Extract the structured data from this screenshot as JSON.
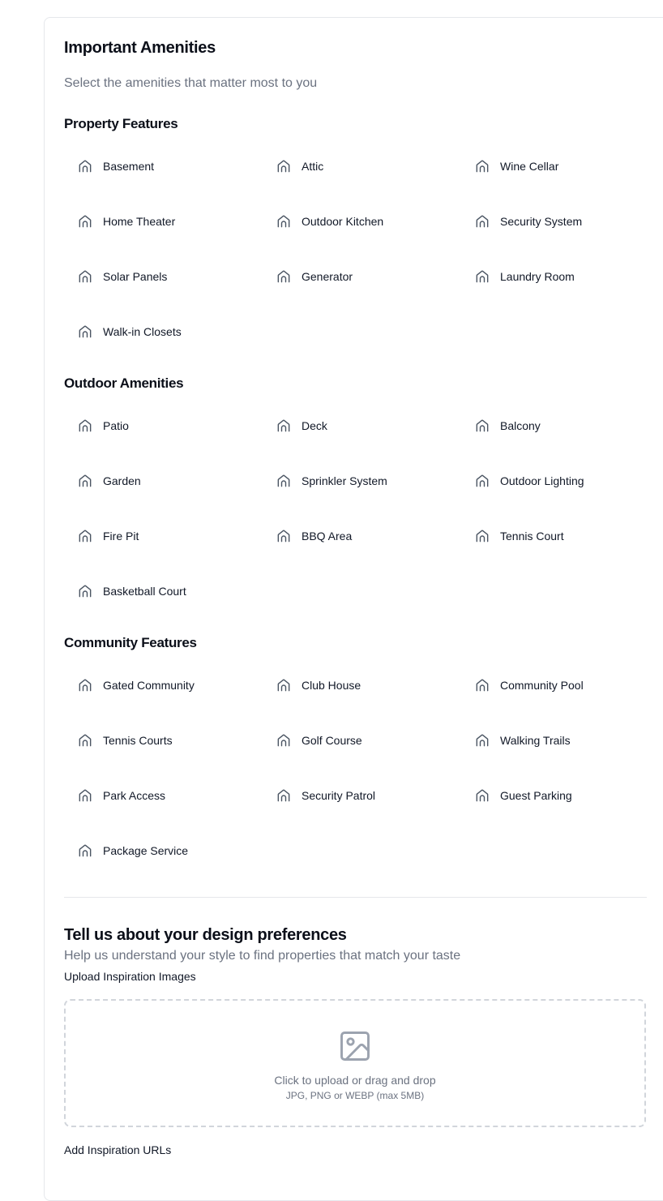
{
  "amenities": {
    "title": "Important Amenities",
    "subtitle": "Select the amenities that matter most to you",
    "groups": [
      {
        "title": "Property Features",
        "items": [
          "Basement",
          "Attic",
          "Wine Cellar",
          "Home Theater",
          "Outdoor Kitchen",
          "Security System",
          "Solar Panels",
          "Generator",
          "Laundry Room",
          "Walk-in Closets"
        ]
      },
      {
        "title": "Outdoor Amenities",
        "items": [
          "Patio",
          "Deck",
          "Balcony",
          "Garden",
          "Sprinkler System",
          "Outdoor Lighting",
          "Fire Pit",
          "BBQ Area",
          "Tennis Court",
          "Basketball Court"
        ]
      },
      {
        "title": "Community Features",
        "items": [
          "Gated Community",
          "Club House",
          "Community Pool",
          "Tennis Courts",
          "Golf Course",
          "Walking Trails",
          "Park Access",
          "Security Patrol",
          "Guest Parking",
          "Package Service"
        ]
      }
    ],
    "item_icon": "home-icon"
  },
  "design": {
    "title": "Tell us about your design preferences",
    "subtitle": "Help us understand your style to find properties that match your taste",
    "upload_label": "Upload Inspiration Images",
    "dropzone_text": "Click to upload or drag and drop",
    "dropzone_hint": "JPG, PNG or WEBP (max 5MB)",
    "dropzone_icon": "image-icon",
    "urls_label": "Add Inspiration URLs"
  }
}
